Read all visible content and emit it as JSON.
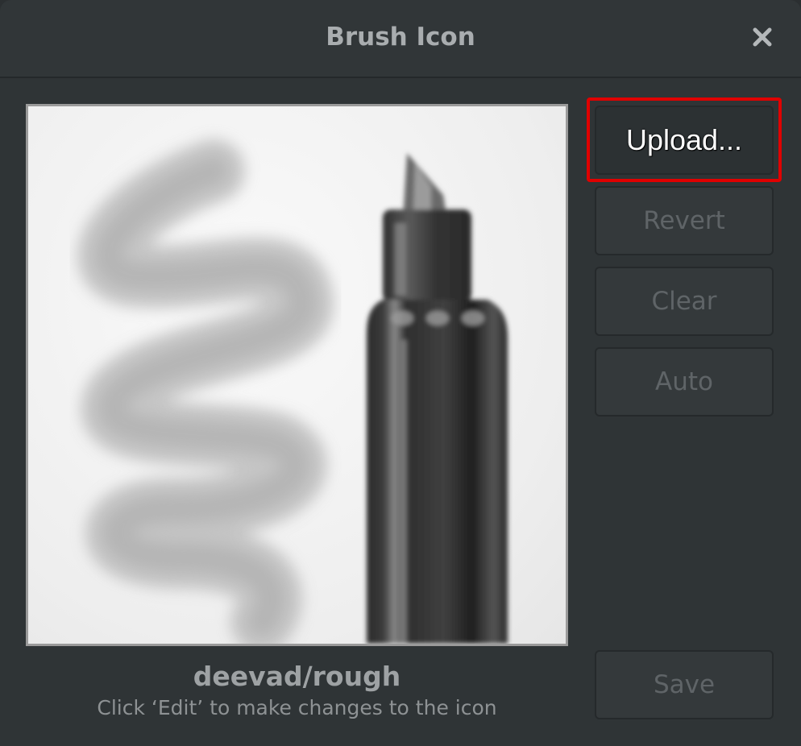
{
  "dialog": {
    "title": "Brush Icon",
    "close_icon": "close-icon"
  },
  "preview": {
    "image": "brush-preview-image"
  },
  "brush": {
    "name": "deevad/rough",
    "hint": "Click ‘Edit’ to make changes to the icon"
  },
  "buttons": {
    "upload": "Upload...",
    "revert": "Revert",
    "clear": "Clear",
    "auto": "Auto",
    "save": "Save"
  },
  "colors": {
    "background": "#2f3436",
    "highlight": "#e00000"
  }
}
